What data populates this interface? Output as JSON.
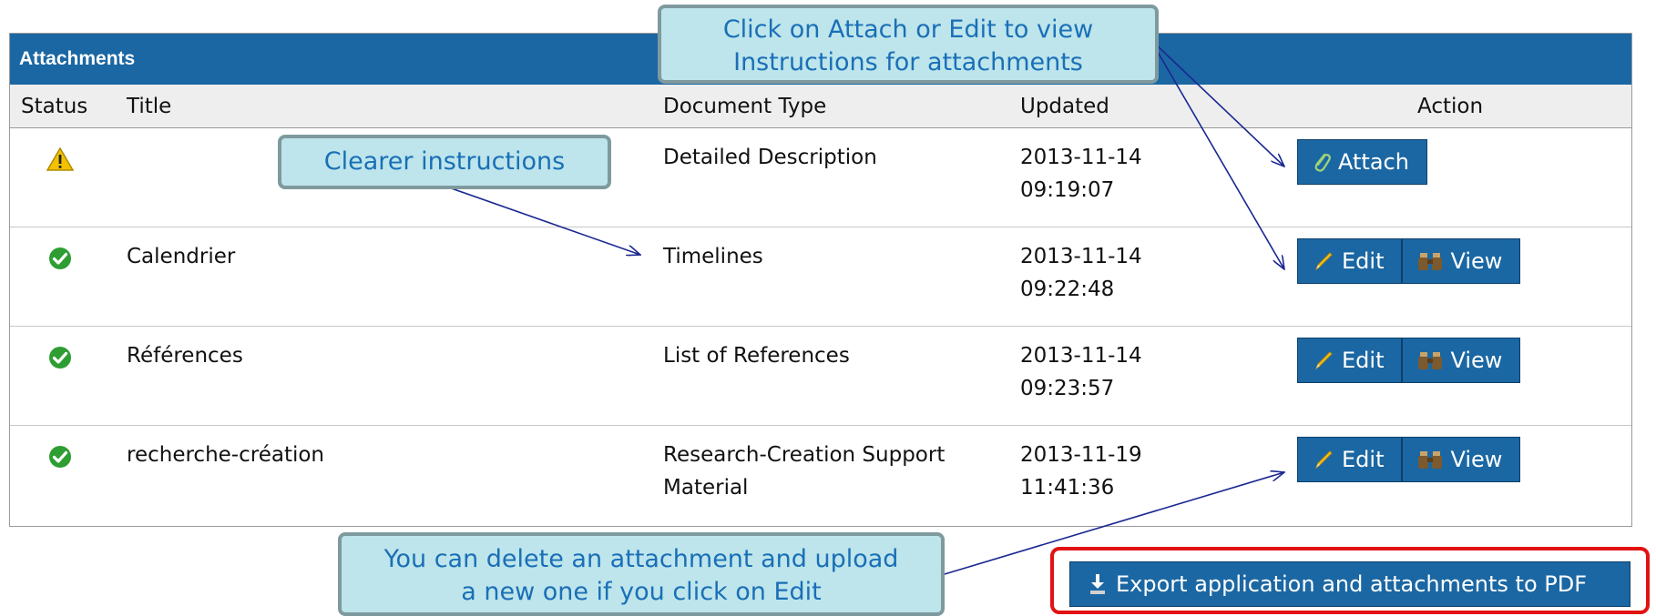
{
  "panel": {
    "title": "Attachments"
  },
  "columns": {
    "status": "Status",
    "title": "Title",
    "document_type": "Document Type",
    "updated": "Updated",
    "action": "Action"
  },
  "rows": [
    {
      "status": "warning",
      "title": "",
      "document_type": [
        "Detailed Description",
        ""
      ],
      "updated": [
        "2013-11-14",
        "09:19:07"
      ]
    },
    {
      "status": "complete",
      "title": "Calendrier",
      "document_type": [
        "Timelines",
        ""
      ],
      "updated": [
        "2013-11-14",
        "09:22:48"
      ]
    },
    {
      "status": "complete",
      "title": "Références",
      "document_type": [
        "List of References",
        ""
      ],
      "updated": [
        "2013-11-14",
        "09:23:57"
      ]
    },
    {
      "status": "complete",
      "title": "recherche-création",
      "document_type": [
        "Research-Creation Support",
        "Material"
      ],
      "updated": [
        "2013-11-19",
        "11:41:36"
      ]
    }
  ],
  "actions": {
    "attach": "Attach",
    "edit": "Edit",
    "view": "View"
  },
  "export_button": "Export application and attachments to PDF",
  "callouts": {
    "top": [
      "Click on Attach or Edit to view",
      "Instructions for attachments"
    ],
    "clearer": [
      "Clearer instructions"
    ],
    "bottom": [
      "You can delete an attachment and upload",
      "a new one if you click on Edit"
    ]
  },
  "colors": {
    "header_blue": "#1b67a3",
    "callout_fill": "#bde5eb",
    "callout_text": "#1a6fb7",
    "highlight_red": "#e21212",
    "ok_green": "#2e9e32",
    "warn_yellow": "#f2c200"
  },
  "icons": {
    "warning": "warning-icon",
    "complete": "check-circle-icon",
    "attach": "paperclip-icon",
    "edit": "pencil-icon",
    "view": "binoculars-icon",
    "export": "download-icon"
  }
}
